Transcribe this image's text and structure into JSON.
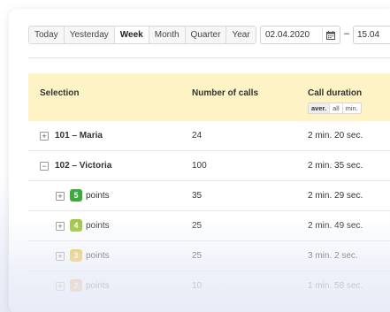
{
  "toolbar": {
    "periods": [
      "Today",
      "Yesterday",
      "Week",
      "Month",
      "Quarter",
      "Year"
    ],
    "active_period": "Week",
    "date_from": "02.04.2020",
    "date_separator": "–",
    "date_to": "15.04"
  },
  "table": {
    "headers": {
      "selection": "Selection",
      "calls": "Number of calls",
      "duration": "Call duration"
    },
    "aggregation": {
      "options": [
        "aver.",
        "all",
        "min."
      ],
      "active": "aver."
    },
    "rows": [
      {
        "toggle": "+",
        "label": "101 – Maria",
        "calls": "24",
        "duration": "2 min. 20 sec."
      },
      {
        "toggle": "−",
        "label": "102 – Victoria",
        "calls": "100",
        "duration": "2 min. 35 sec."
      },
      {
        "toggle": "+",
        "badge": "5",
        "badge_color": "#3cab3c",
        "label": "points",
        "calls": "35",
        "duration": "2 min. 29 sec."
      },
      {
        "toggle": "+",
        "badge": "4",
        "badge_color": "#9cc43a",
        "label": "points",
        "calls": "25",
        "duration": "2 min. 49 sec."
      },
      {
        "toggle": "+",
        "badge": "3",
        "badge_color": "#f0c33a",
        "label": "points",
        "calls": "25",
        "duration": "3 min. 2 sec."
      },
      {
        "toggle": "+",
        "badge": "2",
        "badge_color": "#f0a24a",
        "label": "points",
        "calls": "10",
        "duration": "1 min. 58 sec."
      }
    ]
  },
  "icons": {
    "calendar": "calendar-icon",
    "expand": "plus-square-icon",
    "collapse": "minus-square-icon"
  }
}
